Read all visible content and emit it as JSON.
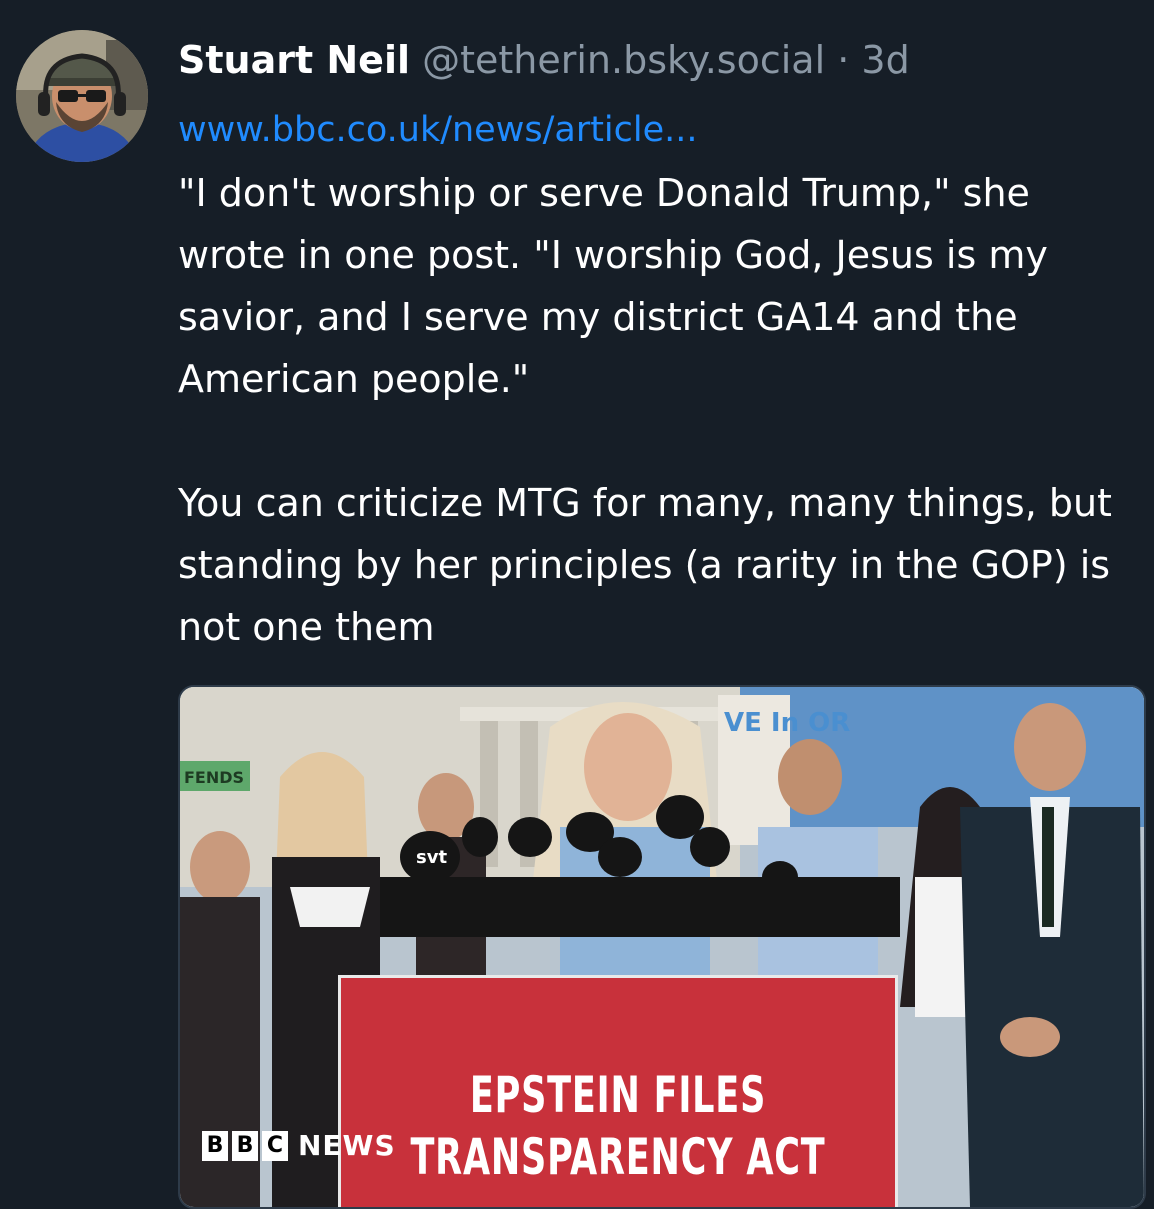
{
  "post": {
    "author_name": "Stuart Neil",
    "handle": "@tetherin.bsky.social",
    "separator": "·",
    "age": "3d",
    "link": "www.bbc.co.uk/news/article...",
    "paragraph1": "\"I don't worship or serve Donald Trump,\" she wrote in one post. \"I worship God, Jesus is my savior, and I serve my district GA14 and the American people.\"",
    "paragraph2": "You can criticize MTG for many, many things, but standing by her principles (a rarity in the GOP) is not one them"
  },
  "embed": {
    "podium_line1": "EPSTEIN FILES",
    "podium_line2": "TRANSPARENCY ACT",
    "mic_label": "svt",
    "sign_text": "VE In OR",
    "banner_text": "FENDS",
    "bbc_letters": [
      "B",
      "B",
      "C"
    ],
    "bbc_news": "NEWS"
  },
  "colors": {
    "background": "#161e27",
    "link": "#208bfe",
    "muted": "#8b98a5",
    "podium": "#c8313b"
  }
}
